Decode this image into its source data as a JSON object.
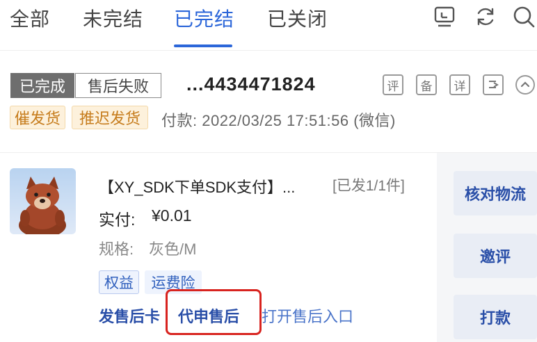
{
  "tabs": [
    {
      "label": "全部"
    },
    {
      "label": "未完结"
    },
    {
      "label": "已完结"
    },
    {
      "label": "已关闭"
    }
  ],
  "active_tab_index": 2,
  "top_icons": [
    "tv-icon",
    "refresh-icon",
    "search-icon"
  ],
  "order": {
    "status_done": "已完成",
    "status_fail": "售后失败",
    "order_no": "...4434471824",
    "mini_buttons": [
      "评",
      "备",
      "详"
    ],
    "urge_tag": "催发货",
    "delay_tag": "推迟发货",
    "pay_info": "付款: 2022/03/25 17:51:56 (微信)"
  },
  "product": {
    "image_icon": "fox-plush-toy",
    "title": "【XY_SDK下单SDK支付】...",
    "ship_status": "[已发1/1件]",
    "paid_label": "实付:",
    "paid_value": "¥0.01",
    "spec_label": "规格:",
    "spec_value": "灰色/M",
    "tags": [
      "权益",
      "运费险"
    ]
  },
  "links": {
    "send_card": "发售后卡",
    "apply_after_sale": "代申售后",
    "open_entry": "打开售后入口"
  },
  "side_buttons": [
    "核对物流",
    "邀评",
    "打款"
  ],
  "colors": {
    "accent": "#2b66d9",
    "highlight": "#d8231f",
    "orange_tag": "#c67c1c",
    "status_gray": "#6e6e6e"
  }
}
